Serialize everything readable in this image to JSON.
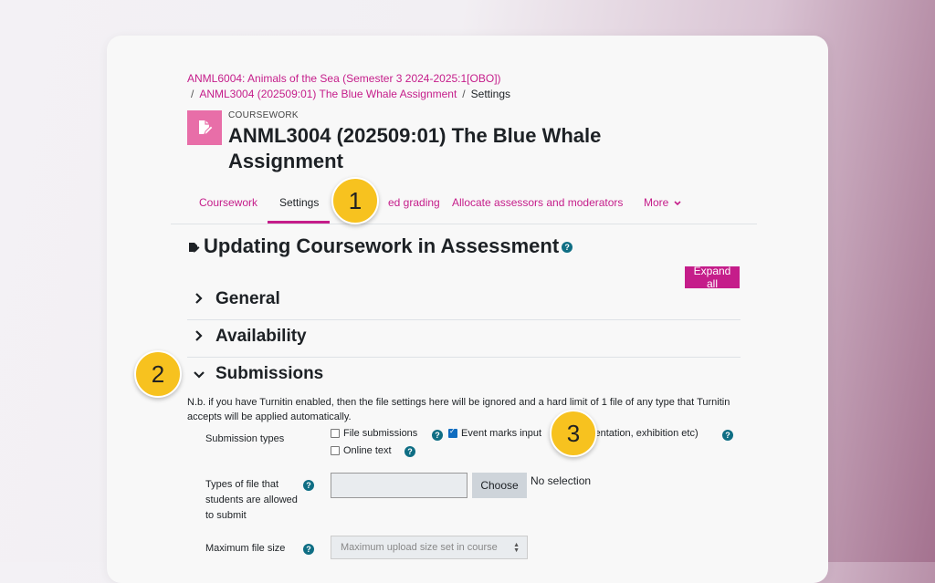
{
  "breadcrumb": {
    "course": "ANML6004: Animals of the Sea (Semester 3 2024-2025:1[OBO])",
    "separator": "/",
    "assignment": "ANML3004 (202509:01) The Blue Whale Assignment",
    "current": "Settings"
  },
  "module": {
    "type_label": "COURSEWORK",
    "title": "ANML3004 (202509:01) The Blue Whale Assignment",
    "icon": "document-edit-icon",
    "icon_color": "#e86ea8"
  },
  "tabs": [
    {
      "label": "Coursework"
    },
    {
      "label": "Settings"
    },
    {
      "label": "ed grading"
    },
    {
      "label": "Allocate assessors and moderators"
    },
    {
      "label": "More"
    }
  ],
  "callouts": [
    "1",
    "2",
    "3"
  ],
  "page": {
    "heading": "Updating Coursework in Assessment",
    "help_glyph": "?",
    "expand_all": "Expand all"
  },
  "sections": {
    "general": "General",
    "availability": "Availability",
    "submissions": "Submissions"
  },
  "submissions": {
    "note": "N.b. if you have Turnitin enabled, then the file settings here will be ignored and a hard limit of 1 file of any type that Turnitin accepts will be applied automatically.",
    "types_label": "Submission types",
    "file_submissions": "File submissions",
    "file_submissions_checked": false,
    "event_marks_input": "Event marks input",
    "event_marks_input_checked": true,
    "event_marks_suffix": "sentation, exhibition etc)",
    "online_text": "Online text",
    "online_text_checked": false,
    "file_types_label": "Types of file that students are allowed to submit",
    "choose_button": "Choose",
    "no_selection": "No selection",
    "max_size_label": "Maximum file size",
    "max_size_value": "Maximum upload size set in course"
  },
  "colors": {
    "brand": "#c51d8a",
    "callout": "#f7c21f",
    "help": "#0f6e84"
  }
}
